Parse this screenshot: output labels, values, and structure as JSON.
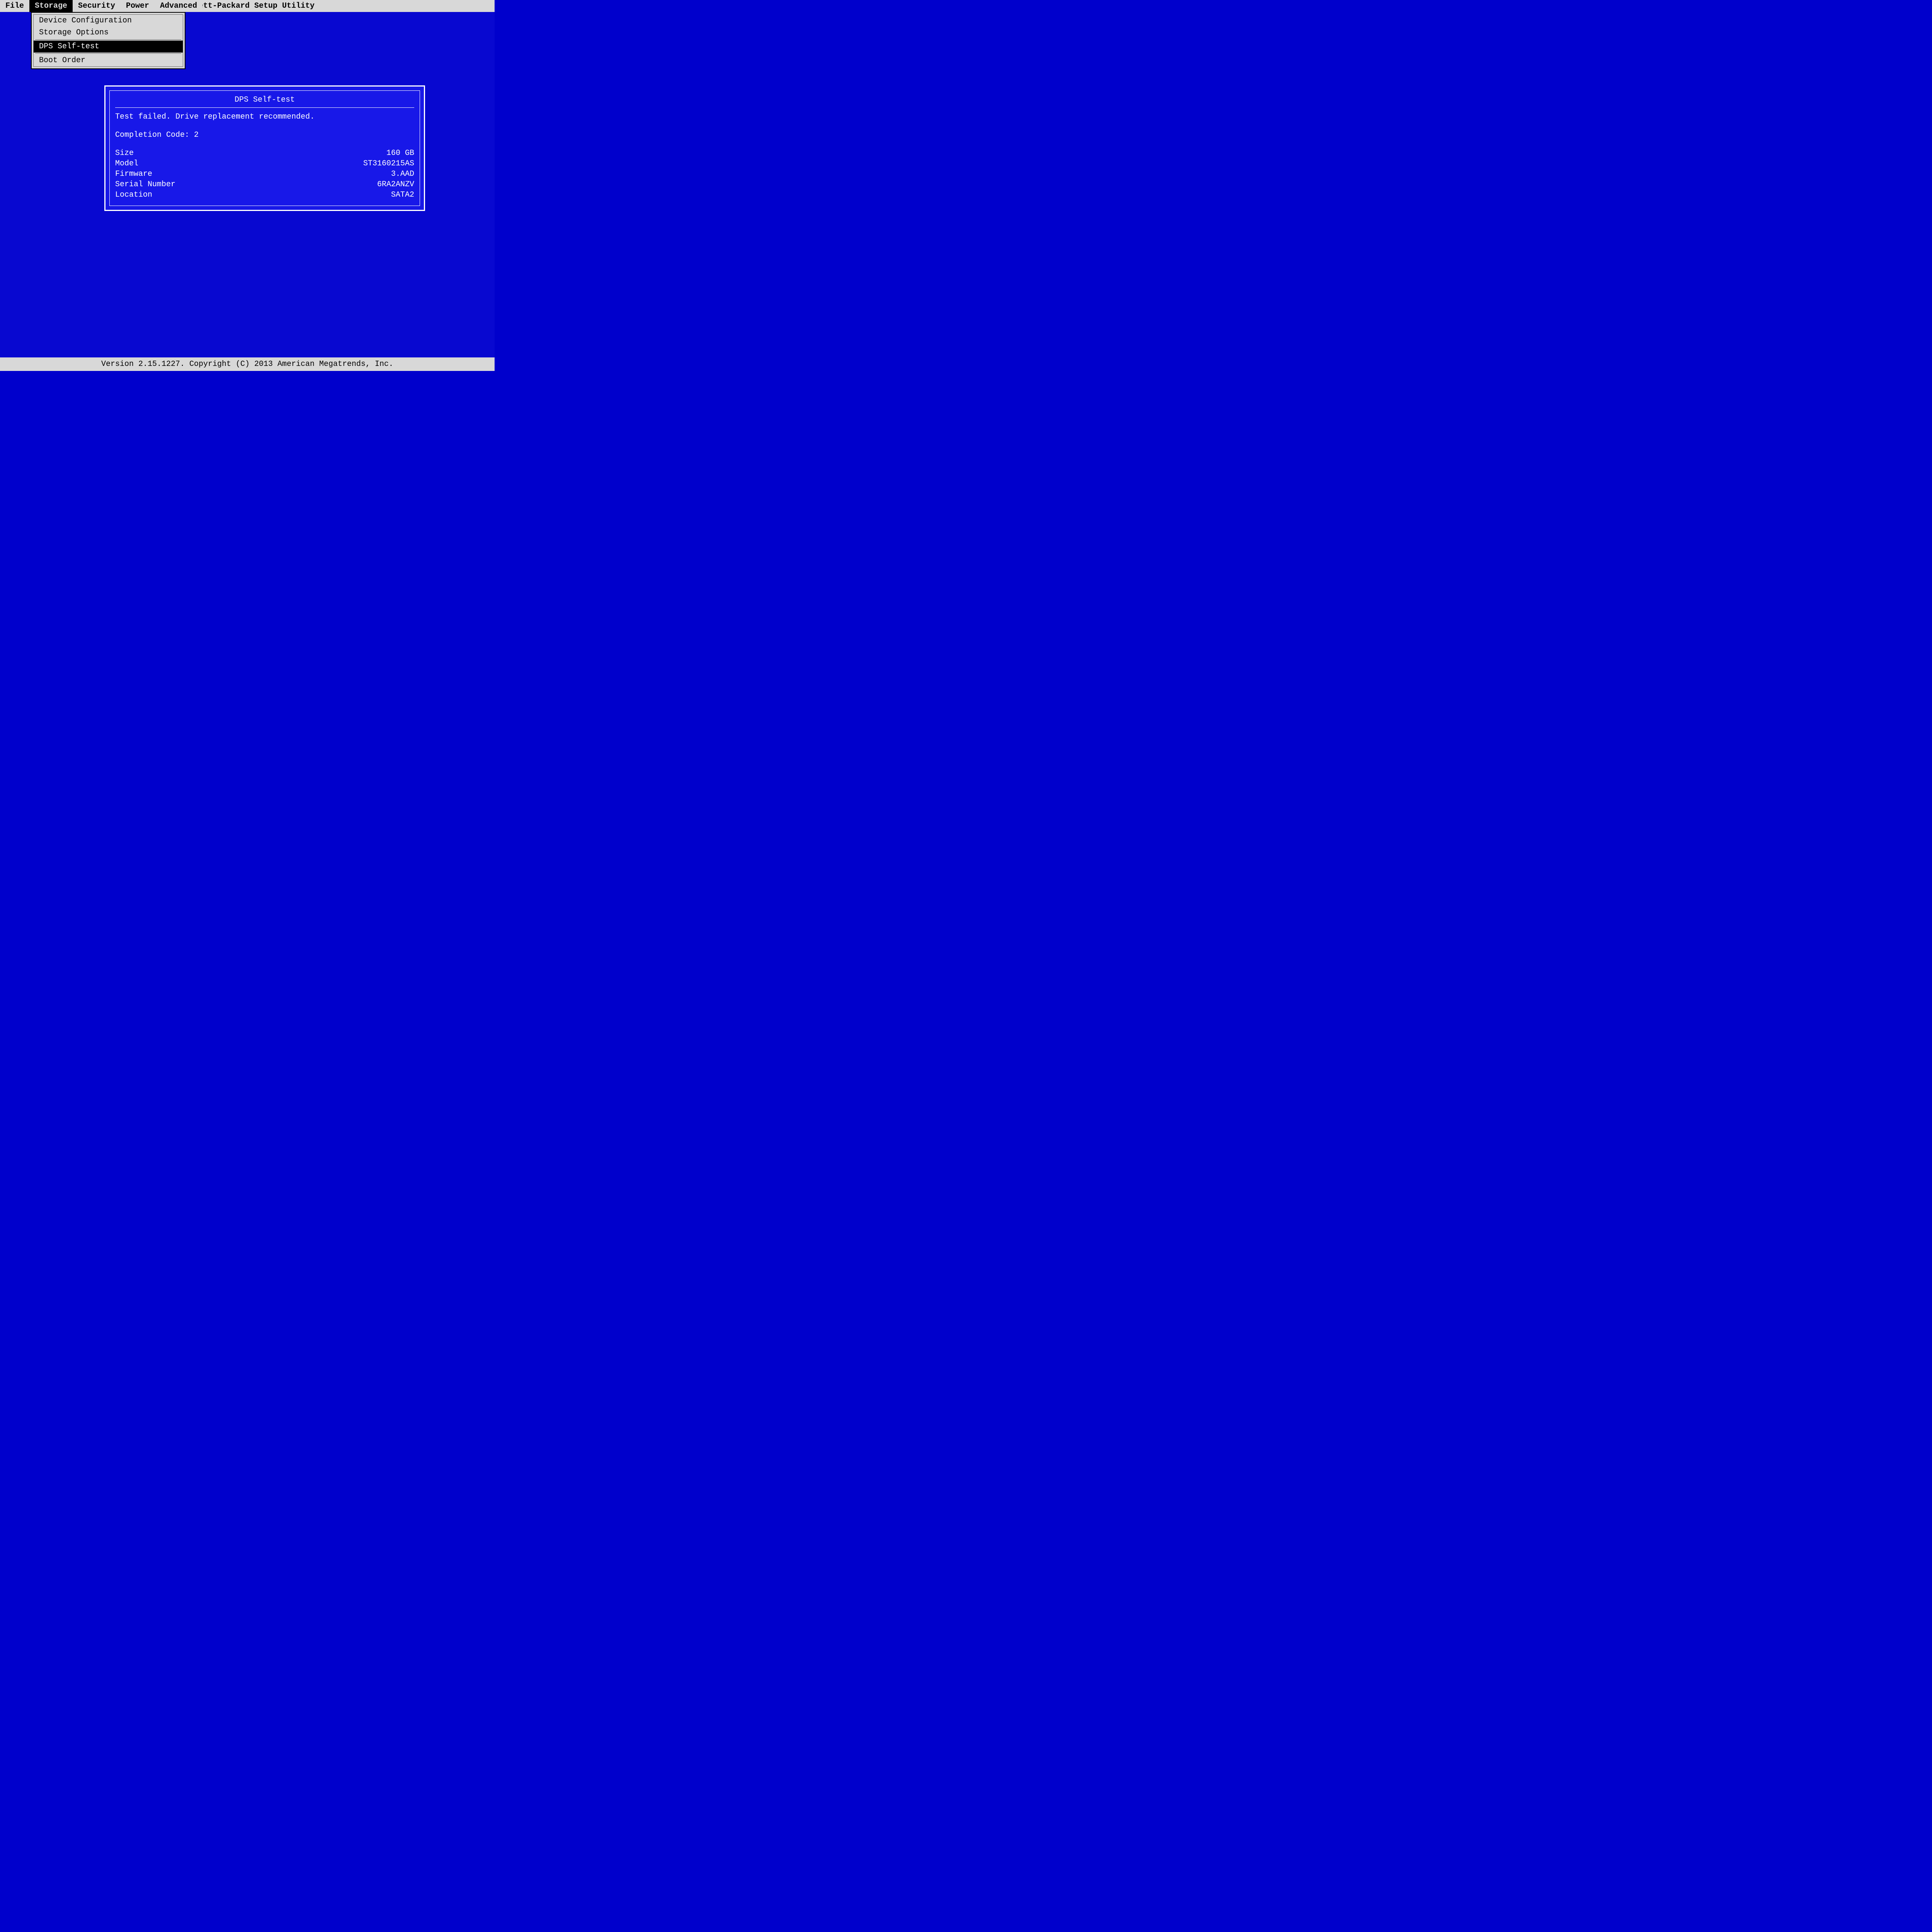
{
  "title": "Hewlett-Packard Setup Utility",
  "menu": {
    "items": [
      "File",
      "Storage",
      "Security",
      "Power",
      "Advanced"
    ],
    "active_index": 1
  },
  "dropdown": {
    "items": [
      {
        "label": "Device Configuration"
      },
      {
        "label": "Storage Options"
      },
      {
        "label": "DPS Self-test",
        "selected": true
      },
      {
        "label": "Boot Order"
      }
    ]
  },
  "dialog": {
    "title": "DPS Self-test",
    "status_line": "Test failed.  Drive replacement recommended.",
    "completion_line": "Completion Code: 2",
    "details": [
      {
        "label": "Size",
        "value": "160 GB"
      },
      {
        "label": "Model",
        "value": "ST3160215AS"
      },
      {
        "label": "Firmware",
        "value": "3.AAD"
      },
      {
        "label": "Serial Number",
        "value": "6RA2ANZV"
      },
      {
        "label": "Location",
        "value": "SATA2"
      }
    ]
  },
  "footer": "Version 2.15.1227. Copyright (C) 2013 American Megatrends, Inc."
}
